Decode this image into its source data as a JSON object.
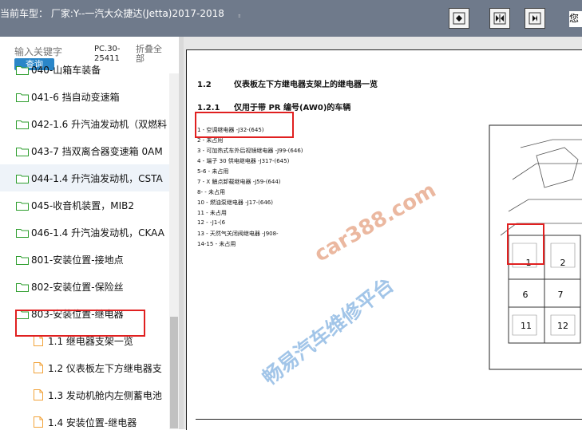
{
  "header": {
    "title": "当前车型：   厂家:Y--一汽大众捷达(Jetta)2017-2018",
    "right_label": "您",
    "icons": [
      "expand-all-icon",
      "expand-collapse-icon",
      "collapse-all-icon"
    ]
  },
  "search": {
    "placeholder": "输入关键字",
    "button": "查询",
    "product_code": "PC.30-25411",
    "collapse_label": "折叠全部"
  },
  "tree": {
    "items": [
      {
        "label": "040-山箱车装备",
        "type": "folder"
      },
      {
        "label": "041-6 挡自动变速箱",
        "type": "folder"
      },
      {
        "label": "042-1.6 升汽油发动机（双燃料",
        "type": "folder"
      },
      {
        "label": "043-7 挡双离合器变速箱 0AM",
        "type": "folder"
      },
      {
        "label": "044-1.4 升汽油发动机，CSTA",
        "type": "folder",
        "highlight": true
      },
      {
        "label": "045-收音机装置，MIB2",
        "type": "folder"
      },
      {
        "label": "046-1.4 升汽油发动机，CKAA",
        "type": "folder"
      },
      {
        "label": "801-安装位置-接地点",
        "type": "folder"
      },
      {
        "label": "802-安装位置-保险丝",
        "type": "folder"
      },
      {
        "label": "803-安装位置-继电器",
        "type": "folder"
      },
      {
        "label": "1.1 继电器支架一览",
        "type": "doc"
      },
      {
        "label": "1.2 仪表板左下方继电器支",
        "type": "doc"
      },
      {
        "label": "1.3 发动机舱内左侧蓄电池",
        "type": "doc"
      },
      {
        "label": "1.4 安装位置-继电器",
        "type": "doc"
      }
    ]
  },
  "document": {
    "section_num": "1.2",
    "section_title": "仪表板左下方继电器支架上的继电器一览",
    "sub_num": "1.2.1",
    "sub_title": "仅用于带 PR 编号(AW0)的车辆",
    "relays": [
      "1 - 空调继电器  -J32-(645)",
      "2 - 未占用",
      "3 - 可加热式车外后视镜继电器  -J99-(646)",
      "4 - 端子 30 供电继电器  -J317-(645)",
      "5-6 - 未占用",
      "7 - X 触点卸载继电器  -J59-(644)",
      "8-      - 未占用",
      "10   - 燃油泵继电器  -J17-(646)",
      "11 - 未占用",
      "12 - -J1-(6",
      "13 - 天然气关闭阀继电器  -J908-",
      "14-15 - 未占用"
    ],
    "diagram_labels": [
      "1",
      "2",
      "6",
      "7",
      "11",
      "12"
    ]
  },
  "watermark": {
    "url": "car388.com",
    "brand": "畅易汽车维修平台"
  },
  "colors": {
    "header_bg": "#6f7a8b",
    "accent_blue": "#2a86c8",
    "highlight_red": "#e02020",
    "folder_green": "#2e9e2e",
    "doc_orange": "#f2a33a"
  }
}
